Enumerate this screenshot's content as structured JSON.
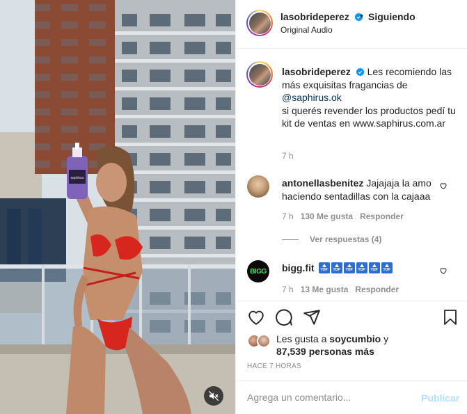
{
  "header": {
    "username": "lasobrideperez",
    "follow_label": "Siguiendo",
    "audio_label": "Original Audio"
  },
  "caption": {
    "username": "lasobrideperez",
    "text_1": "Les recomiendo las más exquisitas fragancias de",
    "mention": "@saphirus.ok",
    "text_2": "si querés revender los productos pedí tu kit de ventas en www.saphirus.com.ar",
    "time": "7 h"
  },
  "comments": [
    {
      "username": "antonellasbenitez",
      "text": "Jajajaja la amo haciendo sentadillas con la cajaaa",
      "time": "7 h",
      "likes": "130 Me gusta",
      "reply_label": "Responder",
      "view_replies": "Ver respuestas (4)"
    },
    {
      "username": "bigg.fit",
      "avatar_text": "BIGG",
      "badges": [
        "TOP",
        "TOP",
        "TOP",
        "TOP",
        "TOP",
        "TOP"
      ],
      "time": "7 h",
      "likes": "13 Me gusta",
      "reply_label": "Responder"
    }
  ],
  "likes_summary": {
    "prefix": "Les gusta a",
    "user": "soycumbio",
    "conj": "y",
    "count": "87,539 personas más"
  },
  "time_ago": "HACE 7 HORAS",
  "add_comment": {
    "placeholder": "Agrega un comentario...",
    "publish_label": "Publicar"
  },
  "media": {
    "product_label": "saphirus"
  },
  "icons": {
    "verified": "verified-badge-icon",
    "heart": "heart-icon",
    "comment": "comment-icon",
    "share": "share-icon",
    "save": "bookmark-icon",
    "mute": "muted-speaker-icon"
  },
  "colors": {
    "verified_blue": "#0095f6",
    "link": "#00376b",
    "muted_text": "#8e8e8e",
    "publish_disabled": "#b2dffc"
  }
}
